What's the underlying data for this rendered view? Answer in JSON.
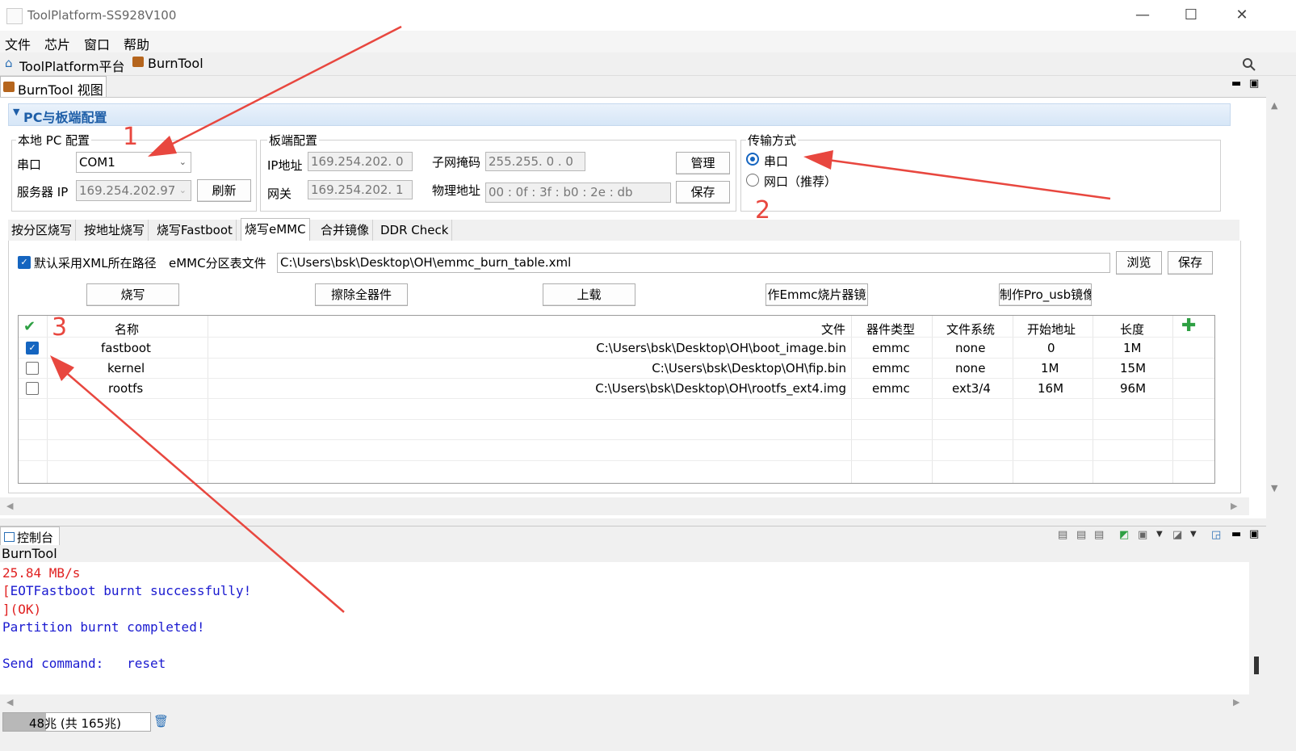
{
  "window": {
    "title": "ToolPlatform-SS928V100"
  },
  "menu": [
    "文件",
    "芯片",
    "窗口",
    "帮助"
  ],
  "toolbar": {
    "items": [
      "ToolPlatform平台",
      "BurnTool"
    ]
  },
  "view_tab": "BurnTool 视图",
  "section": {
    "title": "PC与板端配置"
  },
  "local_pc": {
    "group_label": "本地 PC 配置",
    "serial_label": "串口",
    "serial_value": "COM1",
    "server_ip_label": "服务器 IP",
    "server_ip_value": "169.254.202.97",
    "refresh_button": "刷新"
  },
  "board": {
    "group_label": "板端配置",
    "ip_label": "IP地址",
    "ip_value": "169.254.202. 0",
    "gateway_label": "网关",
    "gateway_value": "169.254.202. 1",
    "subnet_label": "子网掩码",
    "subnet_value": "255.255. 0 . 0",
    "mac_label": "物理地址",
    "mac_value": "00 : 0f : 3f : b0 : 2e : db",
    "manage_button": "管理",
    "save_button": "保存"
  },
  "transfer": {
    "group_label": "传输方式",
    "option_serial": "串口",
    "option_network": "网口（推荐）",
    "selected": "串口"
  },
  "tabs": [
    "按分区烧写",
    "按地址烧写",
    "烧写Fastboot",
    "烧写eMMC",
    "合并镜像",
    "DDR Check"
  ],
  "active_tab": "烧写eMMC",
  "emmc": {
    "default_xml_checkbox": "默认采用XML所在路径",
    "partition_label": "eMMC分区表文件",
    "partition_path": "C:\\Users\\bsk\\Desktop\\OH\\emmc_burn_table.xml",
    "browse_button": "浏览",
    "save_button": "保存",
    "actions": [
      "烧写",
      "擦除全器件",
      "上载",
      "作Emmc烧片器镜",
      "制作Pro_usb镜像"
    ]
  },
  "table": {
    "headers": [
      "名称",
      "文件",
      "器件类型",
      "文件系统",
      "开始地址",
      "长度"
    ],
    "rows": [
      {
        "checked": true,
        "name": "fastboot",
        "file": "C:\\Users\\bsk\\Desktop\\OH\\boot_image.bin",
        "type": "emmc",
        "fs": "none",
        "start": "0",
        "length": "1M"
      },
      {
        "checked": false,
        "name": "kernel",
        "file": "C:\\Users\\bsk\\Desktop\\OH\\fip.bin",
        "type": "emmc",
        "fs": "none",
        "start": "1M",
        "length": "15M"
      },
      {
        "checked": false,
        "name": "rootfs",
        "file": "C:\\Users\\bsk\\Desktop\\OH\\rootfs_ext4.img",
        "type": "emmc",
        "fs": "ext3/4",
        "start": "16M",
        "length": "96M"
      }
    ]
  },
  "console": {
    "tab_label": "控制台",
    "source": "BurnTool",
    "lines": [
      {
        "text": "25.84 MB/s",
        "color": "#e02020"
      },
      {
        "text": "[EOTFastboot burnt successfully!",
        "color": "#e02020"
      },
      {
        "text": "](OK)",
        "color": "#e02020"
      },
      {
        "text": "Partition burnt completed!",
        "color": "#1a1ad0"
      },
      {
        "text": "",
        "color": "#000000"
      },
      {
        "text": "Send command:   reset",
        "color": "#1a1ad0"
      }
    ]
  },
  "status": {
    "memory": "48兆 (共 165兆)"
  },
  "annotations": [
    "1",
    "2",
    "3"
  ],
  "colors": {
    "accent": "#1565c0",
    "annotation": "#e8473f",
    "header_text": "#1f5fa8"
  }
}
